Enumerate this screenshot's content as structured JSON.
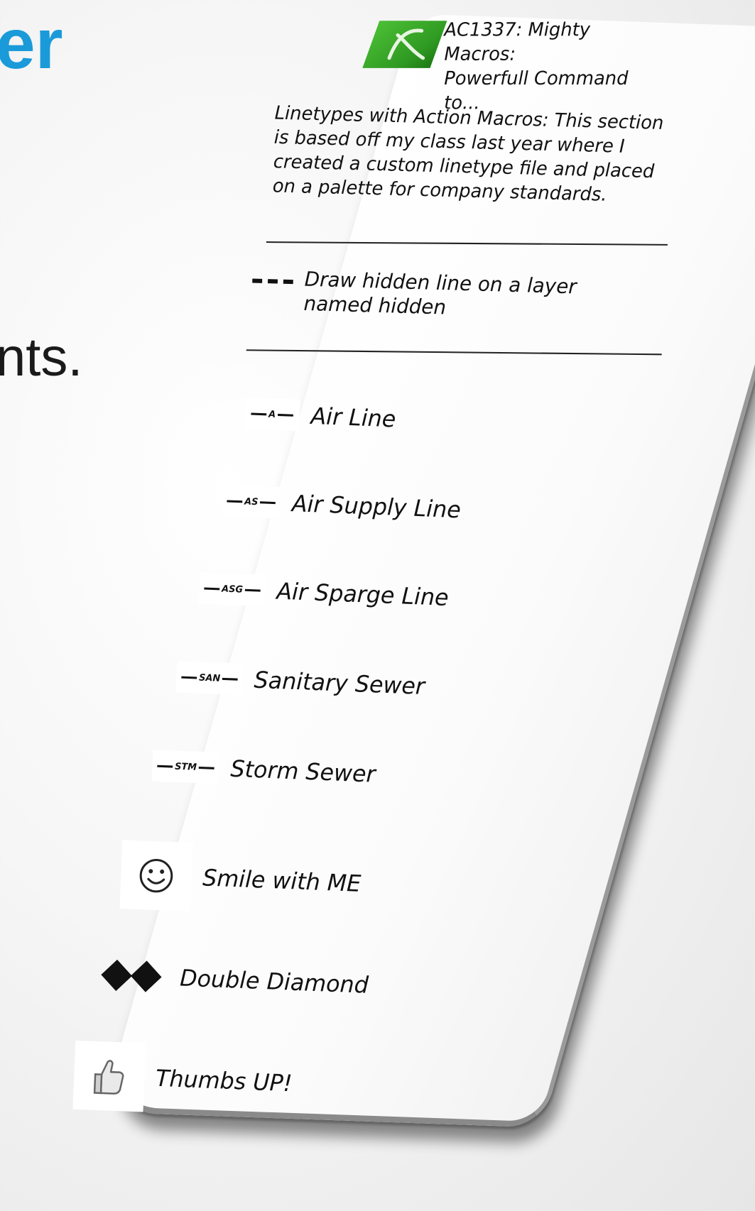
{
  "background": {
    "heading_fragment": "er",
    "body_fragment": "nts."
  },
  "palette": {
    "title": "AC1337:  Mighty Macros:\nPowerfull Command to...",
    "description": "Linetypes with Action Macros: This section is based off my class last year where I created a custom linetype file and placed on a palette for company standards.",
    "hidden_tool": {
      "label": "Draw hidden line on a layer named hidden",
      "icon": "hidden-dashed-line-icon"
    },
    "tools": [
      {
        "code": "A",
        "label": "Air Line"
      },
      {
        "code": "AS",
        "label": "Air Supply Line"
      },
      {
        "code": "ASG",
        "label": "Air Sparge Line"
      },
      {
        "code": "SAN",
        "label": "Sanitary Sewer"
      },
      {
        "code": "STM",
        "label": "Storm Sewer"
      },
      {
        "label": "Smile with ME",
        "icon": "smiley-face-icon"
      },
      {
        "label": "Double Diamond",
        "icon": "double-diamond-icon"
      },
      {
        "label": "Thumbs UP!",
        "icon": "thumbs-up-icon"
      }
    ]
  },
  "colors": {
    "accent_blue": "#1a9ad9",
    "logo_green": "#3aad2a"
  }
}
